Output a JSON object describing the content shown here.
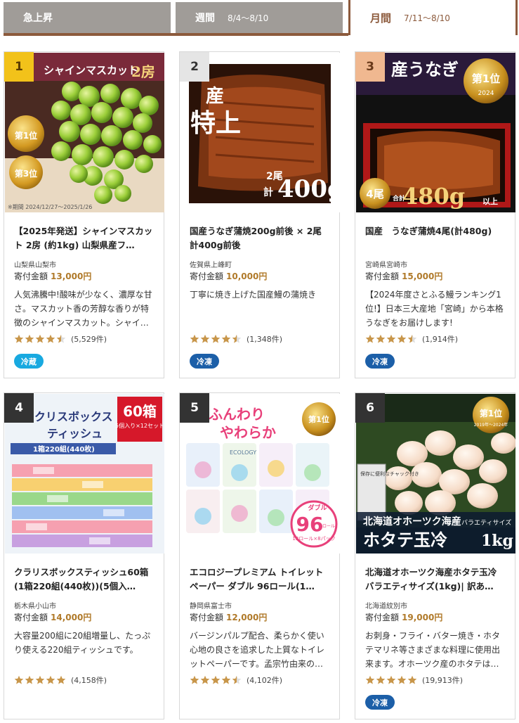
{
  "tabs": [
    {
      "label": "急上昇",
      "dates": ""
    },
    {
      "label": "週間",
      "dates": "8/4〜8/10"
    },
    {
      "label": "月間",
      "dates": "7/11〜8/10"
    }
  ],
  "cards": [
    {
      "rank": "1",
      "title": "【2025年発送】シャインマスカット 2房 (約1kg) 山梨県産フ…",
      "location": "山梨県山梨市",
      "price_label": "寄付金額",
      "price": "13,000円",
      "desc": "人気沸騰中!酸味が少なく、濃厚な甘さ。マスカット香の芳醇な香りが特徴のシャインマスカット。シャイ…",
      "rating": 4.5,
      "reviews": "(5,529件)",
      "badge": "冷蔵",
      "img": {
        "text1": "シャインマスカット",
        "text2": "2房",
        "period": "※期間 2024/12/27〜2025/1/26",
        "award1": "第1位",
        "award2": "第3位"
      }
    },
    {
      "rank": "2",
      "title": "国産うなぎ蒲焼200g前後 × 2尾 計400g前後",
      "location": "佐賀県上峰町",
      "price_label": "寄付金額",
      "price": "10,000円",
      "desc": "丁寧に焼き上げた国産鰻の蒲焼き",
      "rating": 4.5,
      "reviews": "(1,348件)",
      "badge": "冷凍",
      "img": {
        "text1": "特上",
        "text2": "産",
        "weight_prefix": "2尾",
        "weight_kei": "計",
        "weight": "400g"
      }
    },
    {
      "rank": "3",
      "title": "国産　うなぎ蒲焼4尾(計480g)",
      "location": "宮崎県宮崎市",
      "price_label": "寄付金額",
      "price": "15,000円",
      "desc": "【2024年度さとふる鰻ランキング1位!】日本三大産地「宮崎」から本格うなぎをお届けします!",
      "rating": 4.5,
      "reviews": "(1,914件)",
      "badge": "冷凍",
      "img": {
        "text1": "産うなぎ",
        "award": "第1位",
        "award_year": "2024",
        "count": "4尾",
        "kei": "合計",
        "weight": "480g",
        "suffix": "以上"
      }
    },
    {
      "rank": "4",
      "title": "クラリスボックスティッシュ60箱(1箱220組(440枚))(5個入…",
      "location": "栃木県小山市",
      "price_label": "寄付金額",
      "price": "14,000円",
      "desc": "大容量200組に20組増量し、たっぷり使える220組ティッシュです。",
      "rating": 5,
      "reviews": "(4,158件)",
      "badge": "",
      "img": {
        "text1": "クリスボックス",
        "text2": "ティッシュ",
        "count": "60箱",
        "sub": "5個入り×12セット",
        "per": "1箱220組(440枚)"
      }
    },
    {
      "rank": "5",
      "title": "エコロジープレミアム トイレットペーパー ダブル 96ロール(1…",
      "location": "静岡県富士市",
      "price_label": "寄付金額",
      "price": "12,000円",
      "desc": "バージンパルプ配合、柔らかく使い心地の良さを追求した上質なトイレットペーパーです。孟宗竹由来の…",
      "rating": 4.5,
      "reviews": "(4,102件)",
      "badge": "",
      "img": {
        "text1": "ふんわり",
        "text2": "やわらか",
        "award": "第1位",
        "count": "96",
        "unit": "ロール",
        "sub": "12ロール×8パック",
        "double": "ダブル",
        "brand": "ECOLOGY"
      }
    },
    {
      "rank": "6",
      "title": "北海道オホーツク海産ホタテ玉冷 バラエティサイズ(1kg)| 訳あ…",
      "location": "北海道紋別市",
      "price_label": "寄付金額",
      "price": "19,000円",
      "desc": "お刺身・フライ・バター焼き・ホタテマリネ等さまざまな料理に使用出来ます。オホーツク産のホタテは…",
      "rating": 5,
      "reviews": "(19,913件)",
      "badge": "冷凍",
      "img": {
        "text1": "北海道オホーツク海産",
        "text2": "ホタテ玉冷",
        "weight": "1kg",
        "award": "第1位",
        "years": "2019年〜2024年",
        "tag": "保存に便利なチャック付き",
        "variety": "バラエティサイズ"
      }
    }
  ],
  "colors": {
    "star": "#c8964a",
    "star_empty": "#dddddd",
    "price": "#b07a2a",
    "accent": "#8c5a3c",
    "cold": "#18a9e0",
    "frozen": "#1c5fa8"
  }
}
